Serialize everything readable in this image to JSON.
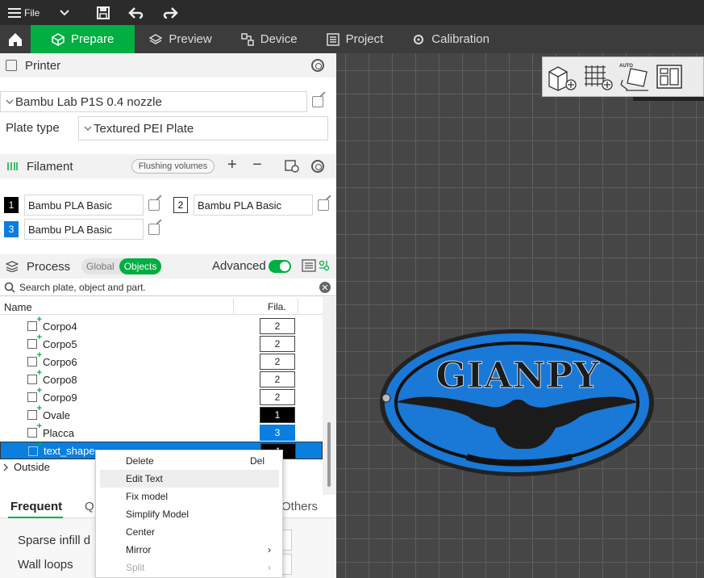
{
  "topbar": {
    "file_label": "File"
  },
  "tabs": [
    {
      "label": "Prepare"
    },
    {
      "label": "Preview"
    },
    {
      "label": "Device"
    },
    {
      "label": "Project"
    },
    {
      "label": "Calibration"
    }
  ],
  "printer": {
    "section_title": "Printer",
    "printer_name": "Bambu Lab P1S 0.4 nozzle",
    "plate_type_label": "Plate type",
    "plate_type_value": "Textured PEI Plate"
  },
  "filament": {
    "section_title": "Filament",
    "flushing_label": "Flushing volumes",
    "slots": [
      {
        "num": "1",
        "name": "Bambu PLA Basic",
        "color": "#000000",
        "text_color": "#ffffff"
      },
      {
        "num": "2",
        "name": "Bambu PLA Basic",
        "color": "#ffffff",
        "text_color": "#000000"
      },
      {
        "num": "3",
        "name": "Bambu PLA Basic",
        "color": "#0a7fe0",
        "text_color": "#ffffff"
      }
    ]
  },
  "process": {
    "section_title": "Process",
    "toggle_global": "Global",
    "toggle_objects": "Objects",
    "advanced_label": "Advanced"
  },
  "search": {
    "placeholder": "Search plate, object and part."
  },
  "object_list": {
    "col_name": "Name",
    "col_fila": "Fila.",
    "rows": [
      {
        "name": "Corpo4",
        "fila": "2"
      },
      {
        "name": "Corpo5",
        "fila": "2"
      },
      {
        "name": "Corpo6",
        "fila": "2"
      },
      {
        "name": "Corpo8",
        "fila": "2"
      },
      {
        "name": "Corpo9",
        "fila": "2"
      },
      {
        "name": "Ovale",
        "fila": "1"
      },
      {
        "name": "Placca",
        "fila": "3"
      },
      {
        "name": "text_shape",
        "fila": "1"
      }
    ],
    "outside_label": "Outside"
  },
  "settings_tabs": {
    "frequent": "Frequent",
    "quality_partial": "Q",
    "others": "Others"
  },
  "settings": {
    "sparse_infill_partial": "Sparse infill d",
    "wall_loops": "Wall loops"
  },
  "context_menu": {
    "items": [
      {
        "label": "Delete",
        "shortcut": "Del"
      },
      {
        "label": "Edit Text"
      },
      {
        "label": "Fix model"
      },
      {
        "label": "Simplify Model"
      },
      {
        "label": "Center"
      },
      {
        "label": "Mirror"
      },
      {
        "label": "Split"
      }
    ]
  },
  "viewport": {
    "model_text": "GIANPY",
    "auto_label": "AUTO"
  },
  "colors": {
    "accent": "#00ae42",
    "selection": "#0a7fe0",
    "model_blue": "#1a78d6"
  }
}
